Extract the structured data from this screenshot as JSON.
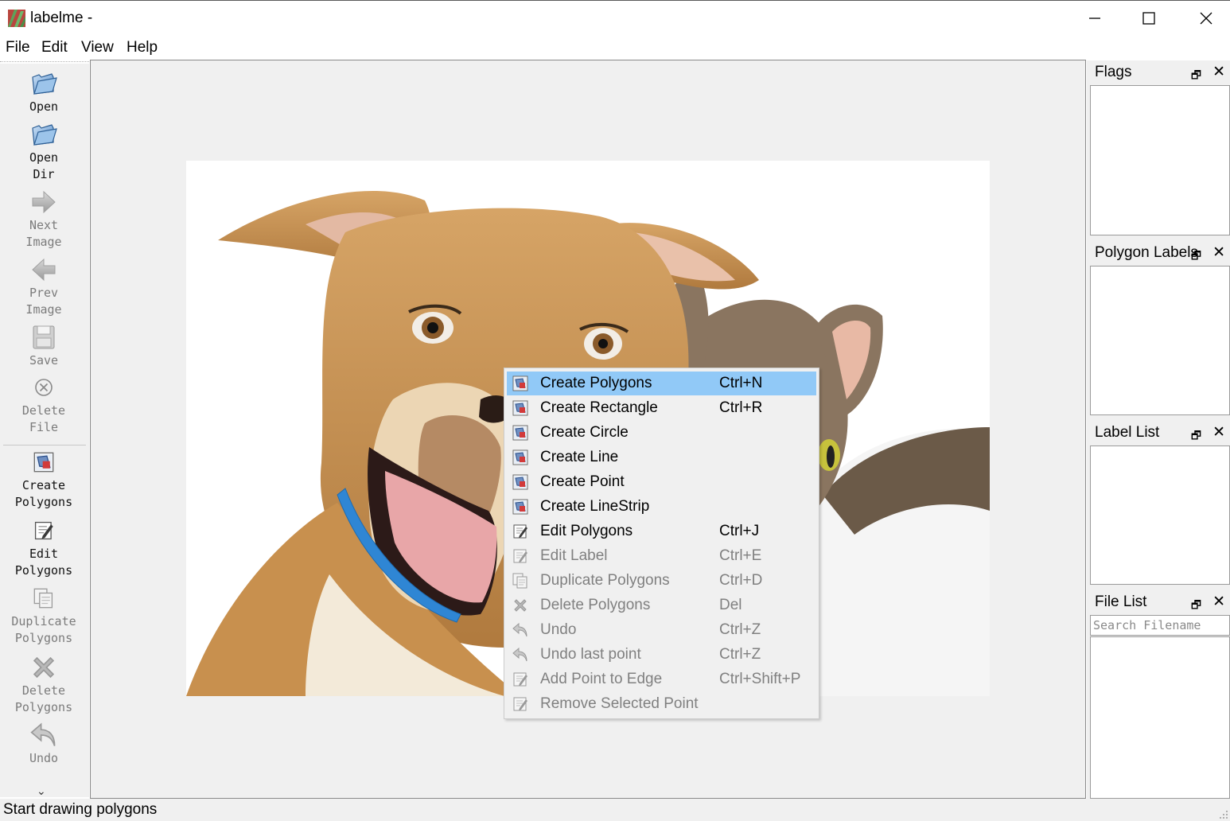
{
  "window": {
    "title": "labelme -",
    "controls": [
      "minimize-icon",
      "maximize-icon",
      "close-icon"
    ]
  },
  "menubar": {
    "items": [
      {
        "label": "File"
      },
      {
        "label": "Edit"
      },
      {
        "label": "View"
      },
      {
        "label": "Help"
      }
    ]
  },
  "toolbar": {
    "items": [
      {
        "label": "Open",
        "icon": "folder-open-icon",
        "enabled": true
      },
      {
        "label": "Open\nDir",
        "icon": "folder-open-icon",
        "enabled": true
      },
      {
        "label": "Next\nImage",
        "icon": "arrow-right-icon",
        "enabled": false
      },
      {
        "label": "Prev\nImage",
        "icon": "arrow-left-icon",
        "enabled": false
      },
      {
        "label": "Save",
        "icon": "floppy-disk-icon",
        "enabled": false
      },
      {
        "label": "Delete\nFile",
        "icon": "delete-circle-icon",
        "enabled": false
      },
      {
        "label": "Create\nPolygons",
        "icon": "polygon-draw-icon",
        "enabled": true
      },
      {
        "label": "Edit\nPolygons",
        "icon": "edit-icon",
        "enabled": true
      },
      {
        "label": "Duplicate\nPolygons",
        "icon": "copy-icon",
        "enabled": false
      },
      {
        "label": "Delete\nPolygons",
        "icon": "x-cross-icon",
        "enabled": false
      },
      {
        "label": "Undo",
        "icon": "undo-arrow-icon",
        "enabled": false
      }
    ],
    "more_icon": "chevron-double-down-icon"
  },
  "context_menu": {
    "items": [
      {
        "label": "Create Polygons",
        "shortcut": "Ctrl+N",
        "icon": "polygon-draw-icon",
        "enabled": true,
        "highlighted": true
      },
      {
        "label": "Create Rectangle",
        "shortcut": "Ctrl+R",
        "icon": "polygon-draw-icon",
        "enabled": true
      },
      {
        "label": "Create Circle",
        "shortcut": "",
        "icon": "polygon-draw-icon",
        "enabled": true
      },
      {
        "label": "Create Line",
        "shortcut": "",
        "icon": "polygon-draw-icon",
        "enabled": true
      },
      {
        "label": "Create Point",
        "shortcut": "",
        "icon": "polygon-draw-icon",
        "enabled": true
      },
      {
        "label": "Create LineStrip",
        "shortcut": "",
        "icon": "polygon-draw-icon",
        "enabled": true
      },
      {
        "label": "Edit Polygons",
        "shortcut": "Ctrl+J",
        "icon": "edit-icon",
        "enabled": true
      },
      {
        "label": "Edit Label",
        "shortcut": "Ctrl+E",
        "icon": "edit-icon",
        "enabled": false
      },
      {
        "label": "Duplicate Polygons",
        "shortcut": "Ctrl+D",
        "icon": "copy-icon",
        "enabled": false
      },
      {
        "label": "Delete Polygons",
        "shortcut": "Del",
        "icon": "x-cross-icon",
        "enabled": false
      },
      {
        "label": "Undo",
        "shortcut": "Ctrl+Z",
        "icon": "undo-arrow-icon",
        "enabled": false
      },
      {
        "label": "Undo last point",
        "shortcut": "Ctrl+Z",
        "icon": "undo-arrow-icon",
        "enabled": false
      },
      {
        "label": "Add Point to Edge",
        "shortcut": "Ctrl+Shift+P",
        "icon": "edit-icon",
        "enabled": false
      },
      {
        "label": "Remove Selected Point",
        "shortcut": "",
        "icon": "edit-icon",
        "enabled": false
      }
    ]
  },
  "docks": {
    "flags": {
      "title": "Flags"
    },
    "polygon_labels": {
      "title": "Polygon Labels"
    },
    "label_list": {
      "title": "Label List"
    },
    "file_list": {
      "title": "File List",
      "search_placeholder": "Search Filename"
    }
  },
  "status": {
    "text": "Start drawing polygons"
  },
  "colors": {
    "highlight": "#91c9f7",
    "panel_bg": "#f0f0f0",
    "disabled_text": "#808080",
    "dog_collar": "#2f86d4"
  },
  "image": {
    "description_icon": "dog-and-cat-photo"
  }
}
